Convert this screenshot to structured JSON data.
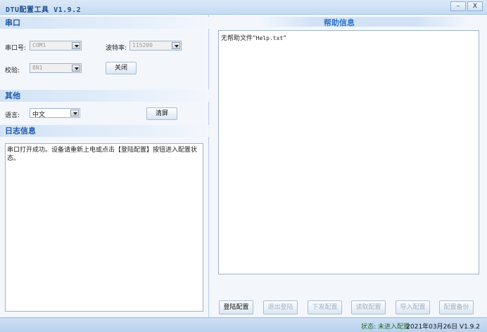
{
  "window": {
    "title": "DTU配置工具 V1.9.2",
    "minimize": "–",
    "close": "X"
  },
  "serial": {
    "header": "串口",
    "port_label": "串口号:",
    "port_value": "COM1",
    "baud_label": "波特率:",
    "baud_value": "115200",
    "parity_label": "校验:",
    "parity_value": "8N1",
    "close_button": "关闭"
  },
  "other": {
    "header": "其他",
    "lang_label": "语言:",
    "lang_value": "中文",
    "clear_button": "清屏"
  },
  "log": {
    "header": "日志信息",
    "text": "串口打开成功。设备请重新上电或点击【登陆配置】按钮进入配置状态。"
  },
  "help": {
    "header": "帮助信息",
    "prefix": "无帮助文件“",
    "filename": "Help.txt",
    "suffix": "”"
  },
  "actions": {
    "login": "登陆配置",
    "logout": "退出登陆",
    "download": "下发配置",
    "read": "读取配置",
    "import": "导入配置",
    "backup": "配置备份"
  },
  "status": {
    "state": "状态: 未进入配置",
    "date_version": "2021年03月26日 V1.9.2"
  },
  "colors": {
    "accent": "#1f5aa8",
    "status_green": "#1f6a2a"
  }
}
